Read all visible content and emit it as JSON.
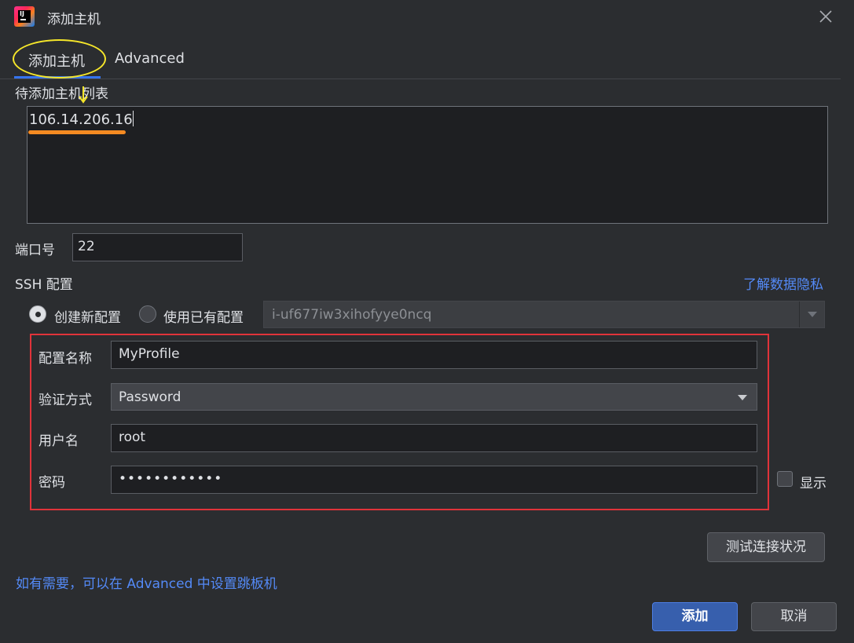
{
  "window": {
    "title": "添加主机",
    "close_icon": "close-icon"
  },
  "tabs": [
    {
      "label": "添加主机",
      "active": true
    },
    {
      "label": "Advanced",
      "active": false
    }
  ],
  "host_list": {
    "label": "待添加主机列表",
    "value": "106.14.206.16"
  },
  "port": {
    "label": "端口号",
    "value": "22"
  },
  "ssh": {
    "label": "SSH 配置",
    "privacy_link": "了解数据隐私",
    "radio_new": "创建新配置",
    "radio_existing": "使用已有配置",
    "existing_value": "i-uf677iw3xihofyye0ncq",
    "selected": "new"
  },
  "profile": {
    "name_label": "配置名称",
    "name_value": "MyProfile",
    "auth_label": "验证方式",
    "auth_value": "Password",
    "user_label": "用户名",
    "user_value": "root",
    "pass_label": "密码",
    "pass_value": "••••••••••••",
    "show_label": "显示",
    "show_checked": false
  },
  "actions": {
    "test": "测试连接状况",
    "hint": "如有需要，可以在 Advanced 中设置跳板机",
    "add": "添加",
    "cancel": "取消"
  },
  "colors": {
    "background": "#2b2d30",
    "accent": "#3574f0",
    "link": "#548af7",
    "annotation_yellow": "#f5e62a",
    "annotation_orange": "#f58a22",
    "annotation_red": "#e0333a"
  }
}
